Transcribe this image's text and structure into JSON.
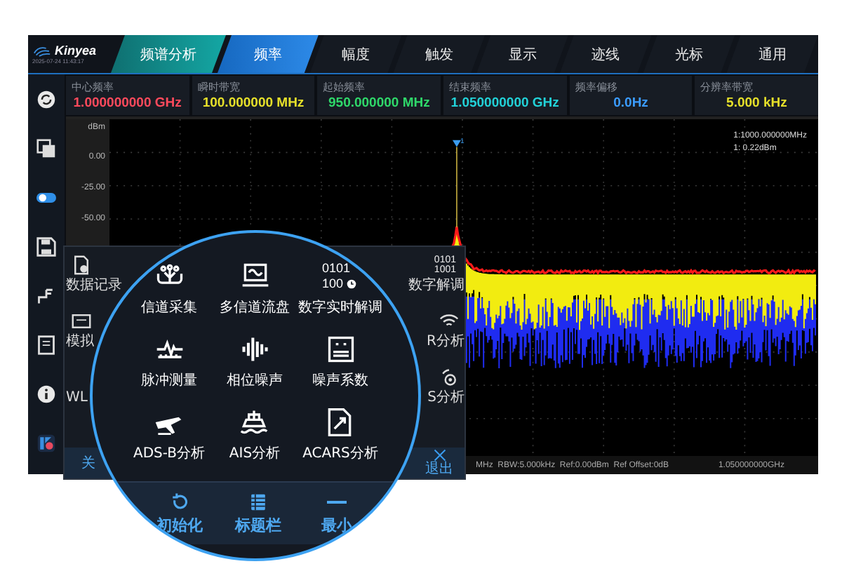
{
  "header": {
    "brand": "Kinyea",
    "datetime": "2025-07-24 11:43:17",
    "mode": "频谱分析",
    "tabs": [
      {
        "label": "频率",
        "selected": true
      },
      {
        "label": "幅度",
        "selected": false
      },
      {
        "label": "触发",
        "selected": false
      },
      {
        "label": "显示",
        "selected": false
      },
      {
        "label": "迹线",
        "selected": false
      },
      {
        "label": "光标",
        "selected": false
      },
      {
        "label": "通用",
        "selected": false
      }
    ]
  },
  "parameters": [
    {
      "label": "中心频率",
      "value": "1.000000000 GHz",
      "color": "#ff4a5c"
    },
    {
      "label": "瞬时带宽",
      "value": "100.000000 MHz",
      "color": "#e6e02a"
    },
    {
      "label": "起始频率",
      "value": "950.000000 MHz",
      "color": "#2fd86a"
    },
    {
      "label": "结束频率",
      "value": "1.050000000 GHz",
      "color": "#22d2d8"
    },
    {
      "label": "频率偏移",
      "value": "0.0Hz",
      "color": "#3b9cff"
    },
    {
      "label": "分辨率带宽",
      "value": "5.000 kHz",
      "color": "#e6e02a"
    }
  ],
  "chart": {
    "unit": "dBm",
    "yticks": [
      "0.00",
      "-25.00",
      "-50.00"
    ],
    "marker": {
      "label": "1",
      "frequency": "1:1000.000000MHz",
      "amplitude": "1: 0.22dBm"
    }
  },
  "status_bar": {
    "settings": "MHz  RBW:5.000kHz  Ref:0.00dBm  Ref Offset:0dB",
    "stop_frequency": "1.050000000GHz"
  },
  "app_menu": {
    "left_items": [
      {
        "label": "数据记录",
        "kind": "document"
      },
      {
        "label": "模拟",
        "kind": "panel"
      },
      {
        "label": "WL",
        "kind": "none"
      }
    ],
    "right_items": [
      {
        "label": "数字解调",
        "kind": "binary",
        "glyph_lines": [
          "0101",
          "1001"
        ]
      },
      {
        "label": "R分析",
        "kind": "wifi"
      },
      {
        "label": "S分析",
        "kind": "radar"
      }
    ],
    "bottom_left": "关",
    "exit": "退出"
  },
  "magnifier": {
    "items": [
      {
        "label": "信道采集",
        "kind": "antenna"
      },
      {
        "label": "多信道流盘",
        "kind": "monitor"
      },
      {
        "label": "数字实时解调",
        "kind": "binary"
      },
      {
        "label": "脉冲测量",
        "kind": "pulse"
      },
      {
        "label": "相位噪声",
        "kind": "wave"
      },
      {
        "label": "噪声系数",
        "kind": "meter"
      },
      {
        "label": "ADS-B分析",
        "kind": "plane"
      },
      {
        "label": "AIS分析",
        "kind": "ship"
      },
      {
        "label": "ACARS分析",
        "kind": "doc-plane"
      }
    ],
    "binary_icon_text": [
      "0101",
      "100"
    ],
    "bottom_bar": [
      {
        "label": "初始化",
        "kind": "reset"
      },
      {
        "label": "标题栏",
        "kind": "list"
      },
      {
        "label": "最小",
        "kind": "minus"
      }
    ]
  }
}
